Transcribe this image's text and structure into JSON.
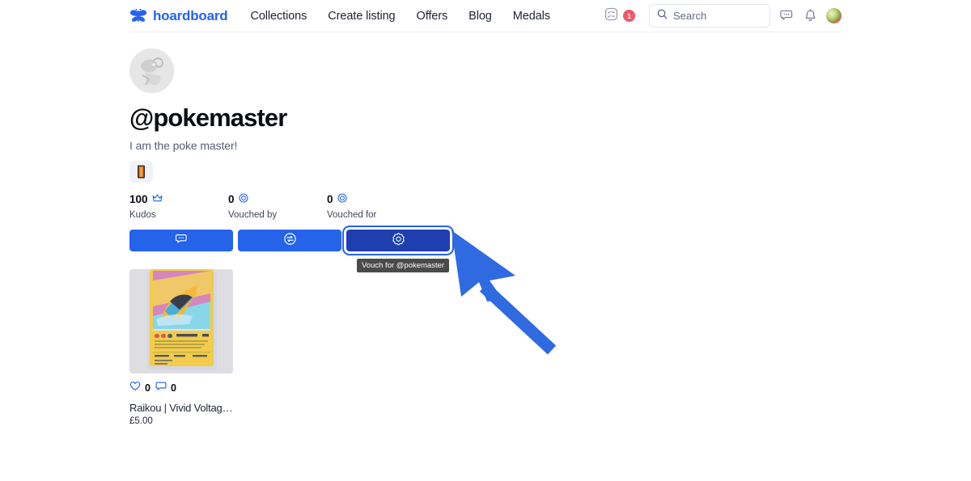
{
  "header": {
    "brand": {
      "name": "hoardboard",
      "logo_icon": "butterfly-logo-icon",
      "color": "#2563eb"
    },
    "nav": [
      {
        "label": "Collections"
      },
      {
        "label": "Create listing"
      },
      {
        "label": "Offers"
      },
      {
        "label": "Blog"
      },
      {
        "label": "Medals"
      }
    ],
    "list_icon": "list-checklist-icon",
    "notification_badge": "1",
    "search": {
      "placeholder": "Search",
      "value": "",
      "icon": "search-icon"
    },
    "messages_icon": "chat-bubbles-icon",
    "notifications_icon": "bell-icon",
    "avatar_icon": "user-avatar"
  },
  "profile": {
    "avatar_alt": "pokemaster-avatar",
    "username": "@pokemaster",
    "bio": "I am the poke master!",
    "medal_icon": "medal-badge-icon",
    "stats": [
      {
        "value": "100",
        "label": "Kudos",
        "icon": "crown-icon"
      },
      {
        "value": "0",
        "label": "Vouched by",
        "icon": "vouch-target-icon"
      },
      {
        "value": "0",
        "label": "Vouched for",
        "icon": "vouch-target-icon"
      }
    ],
    "actions": [
      {
        "name": "message-button",
        "icon": "chat-bubble-icon",
        "focused": false
      },
      {
        "name": "trade-button",
        "icon": "swap-circle-icon",
        "focused": false
      },
      {
        "name": "vouch-button",
        "icon": "vouch-badge-icon",
        "focused": true
      }
    ],
    "tooltip": "Vouch for @pokemaster"
  },
  "listings": [
    {
      "title": "Raikou | Vivid Voltage |...",
      "price": "£5.00",
      "likes": "0",
      "comments": "0",
      "like_icon": "heart-icon",
      "comment_icon": "comment-icon",
      "image_alt": "raikou-pokemon-card"
    }
  ],
  "annotation": {
    "pointer_icon": "arrow-cursor-pointer",
    "color": "#2f6ae0"
  }
}
